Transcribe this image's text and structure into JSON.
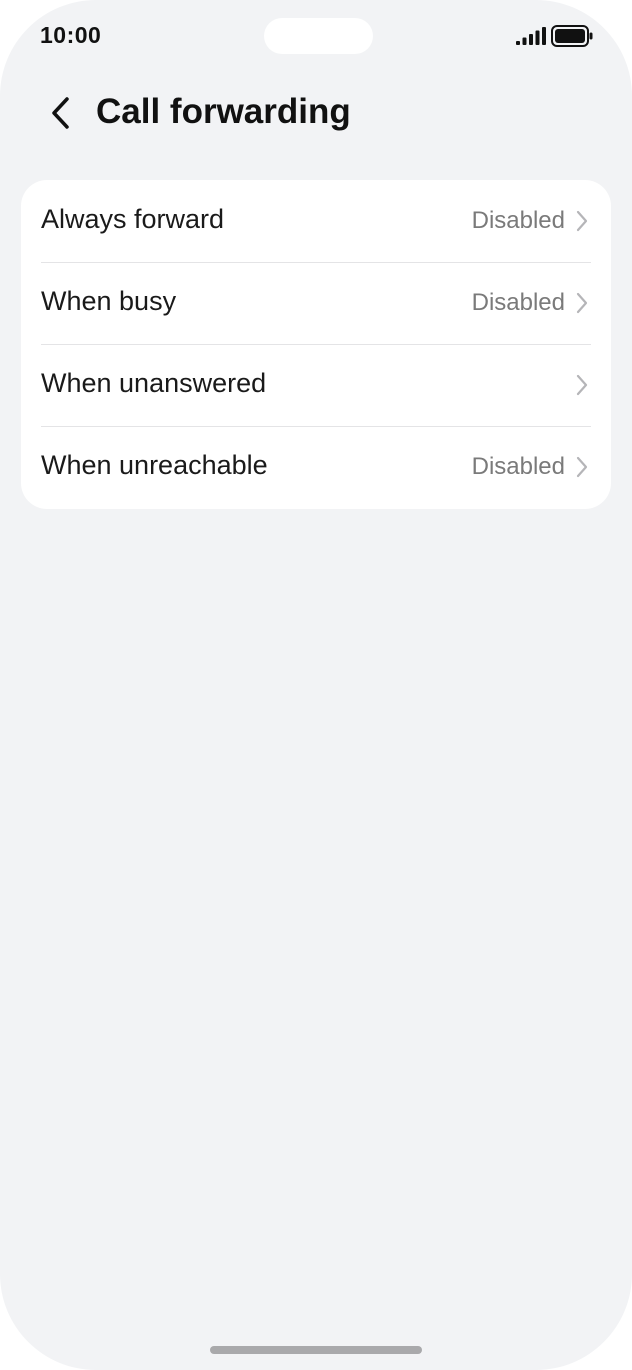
{
  "status_bar": {
    "time": "10:00",
    "signal_icon": "cellular-signal-icon",
    "battery_icon": "battery-full-icon"
  },
  "header": {
    "back_icon": "chevron-left-icon",
    "title": "Call forwarding"
  },
  "settings": {
    "items": [
      {
        "label": "Always forward",
        "value": "Disabled",
        "icon": "chevron-right-icon"
      },
      {
        "label": "When busy",
        "value": "Disabled",
        "icon": "chevron-right-icon"
      },
      {
        "label": "When unanswered",
        "value": "",
        "icon": "chevron-right-icon"
      },
      {
        "label": "When unreachable",
        "value": "Disabled",
        "icon": "chevron-right-icon"
      }
    ]
  },
  "colors": {
    "background": "#f2f3f5",
    "card": "#ffffff",
    "text_primary": "#1a1a1a",
    "text_secondary": "#7a7a7a"
  }
}
